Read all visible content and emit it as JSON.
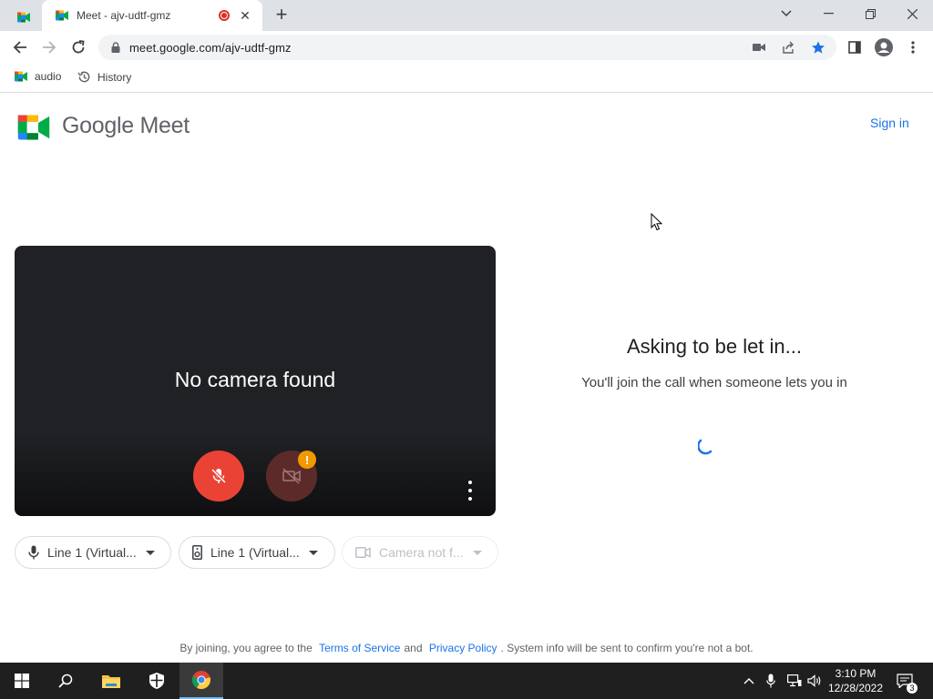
{
  "browser": {
    "active_tab_title": "Meet - ajv-udtf-gmz",
    "url": "meet.google.com/ajv-udtf-gmz",
    "bookmarks": [
      {
        "label": "audio"
      },
      {
        "label": "History"
      }
    ]
  },
  "header": {
    "brand": "Google Meet",
    "sign_in": "Sign in"
  },
  "preview": {
    "message": "No camera found",
    "mic_state": "muted",
    "camera_state": "unavailable",
    "warning_badge": "!"
  },
  "devices": [
    {
      "label": "Line 1 (Virtual...",
      "icon": "microphone-icon"
    },
    {
      "label": "Line 1 (Virtual...",
      "icon": "speaker-icon"
    },
    {
      "label": "Camera not f...",
      "icon": "camera-icon"
    }
  ],
  "status": {
    "title": "Asking to be let in...",
    "subtitle": "You'll join the call when someone lets you in"
  },
  "footer": {
    "prefix": "By joining, you agree to the",
    "terms": "Terms of Service",
    "and": "and",
    "privacy": "Privacy Policy",
    "suffix": ". System info will be sent to confirm you're not a bot."
  },
  "taskbar": {
    "time": "3:10 PM",
    "date": "12/28/2022",
    "notifications": "3"
  },
  "colors": {
    "accent": "#1a73e8",
    "mic_red": "#ea4335",
    "cam_dark_red": "#5c2b29",
    "warning": "#f29900"
  }
}
